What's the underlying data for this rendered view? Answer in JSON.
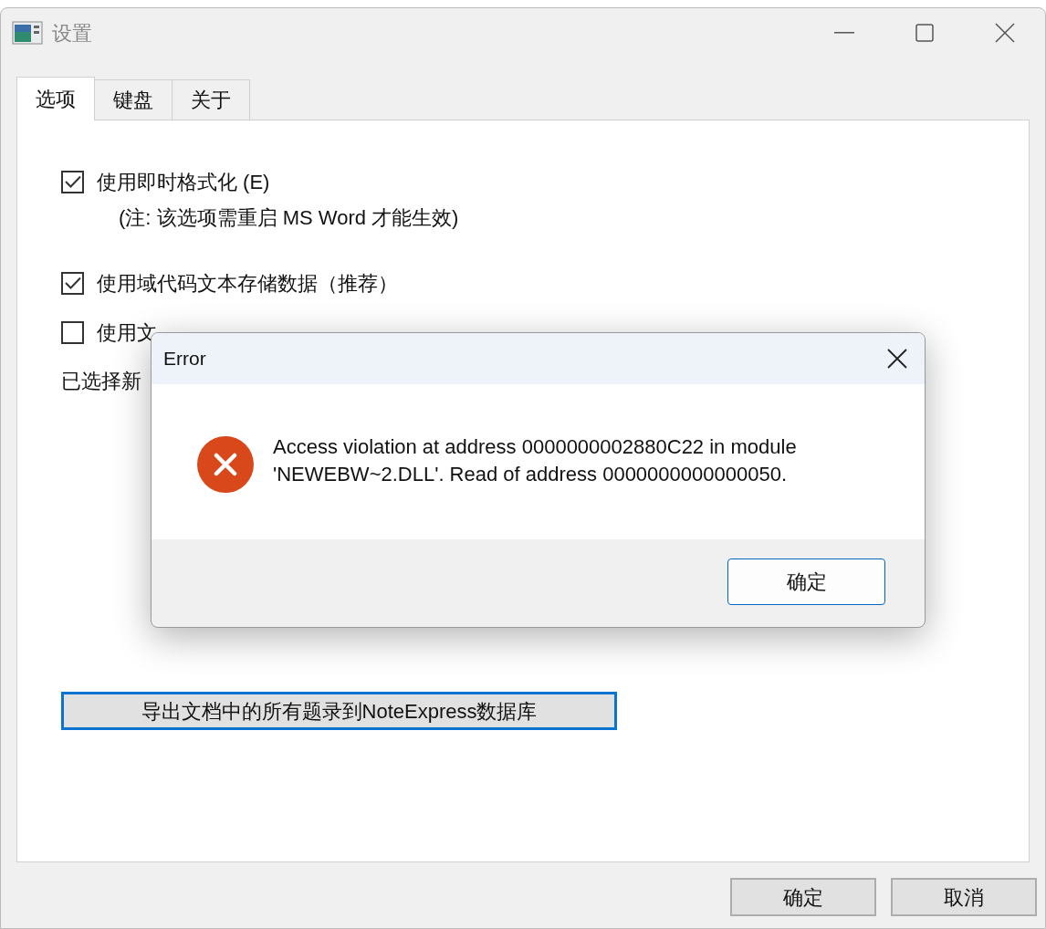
{
  "window": {
    "title": "设置"
  },
  "tabs": [
    {
      "label": "选项",
      "selected": true
    },
    {
      "label": "键盘",
      "selected": false
    },
    {
      "label": "关于",
      "selected": false
    }
  ],
  "options": [
    {
      "kind": "checkbox",
      "label": "使用即时格式化 (E)",
      "checked": true
    },
    {
      "kind": "note",
      "text": "(注: 该选项需重启 MS Word 才能生效)"
    },
    {
      "kind": "checkbox",
      "label": "使用域代码文本存储数据（推荐）",
      "checked": true
    },
    {
      "kind": "checkbox",
      "label": "使用文",
      "checked": false
    },
    {
      "kind": "text",
      "text": "已选择新"
    }
  ],
  "export_button": "导出文档中的所有题录到NoteExpress数据库",
  "buttons": [
    "确定",
    "取消"
  ],
  "error_dialog": {
    "title": "Error",
    "message": "Access violation at address 0000000002880C22 in module 'NEWEBW~2.DLL'. Read of address 0000000000000050.",
    "button": "确定"
  }
}
